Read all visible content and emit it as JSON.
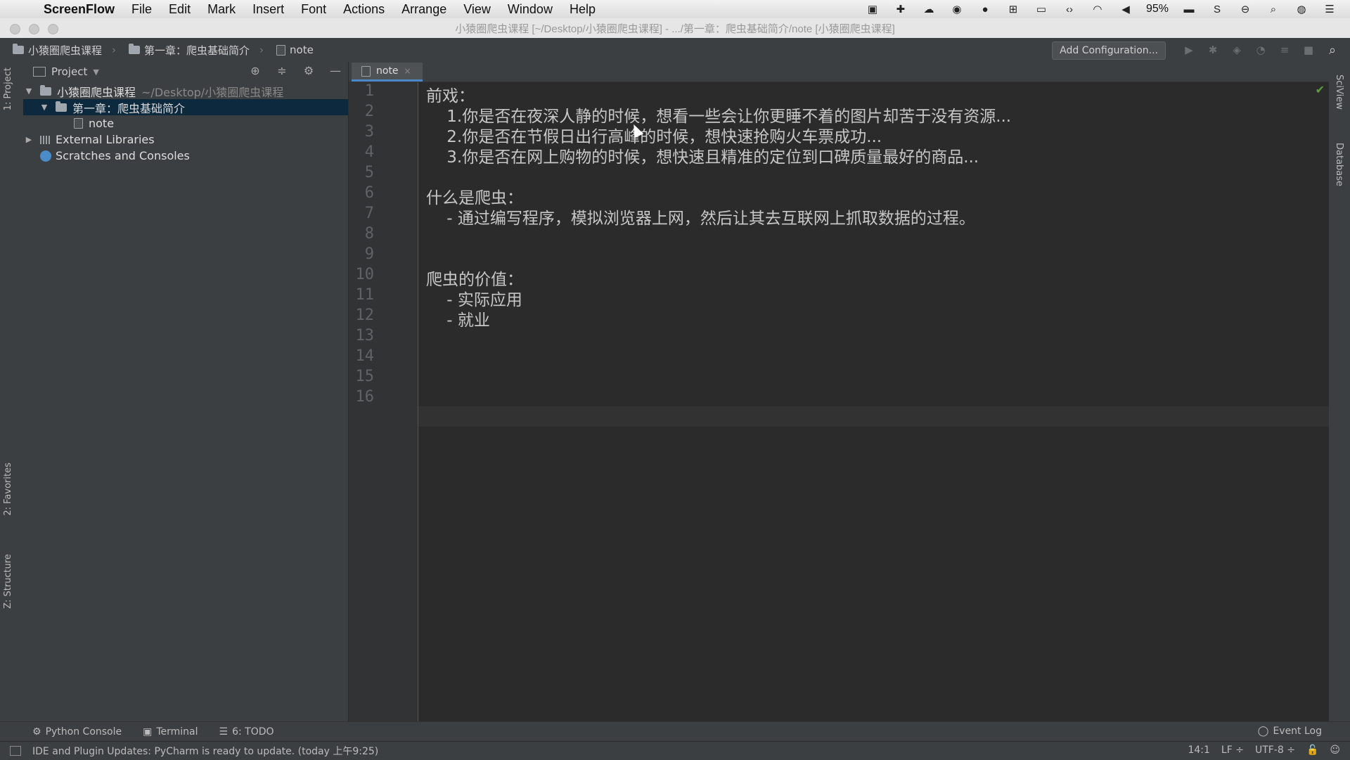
{
  "menubar": {
    "app_name": "ScreenFlow",
    "items": [
      "File",
      "Edit",
      "Mark",
      "Insert",
      "Font",
      "Actions",
      "Arrange",
      "View",
      "Window",
      "Help"
    ],
    "battery": "95%"
  },
  "window": {
    "title": "小猿圈爬虫课程 [~/Desktop/小猿圈爬虫课程] - .../第一章：爬虫基础简介/note [小猿圈爬虫课程]"
  },
  "navbar": {
    "crumbs": [
      "小猿圈爬虫课程",
      "第一章：爬虫基础简介",
      "note"
    ],
    "add_config": "Add Configuration..."
  },
  "left_strip": {
    "project": "1: Project",
    "favorites": "2: Favorites",
    "structure": "Z: Structure"
  },
  "right_strip": {
    "sciview": "SciView",
    "database": "Database"
  },
  "project_panel": {
    "title": "Project",
    "root_name": "小猿圈爬虫课程",
    "root_path": "~/Desktop/小猿圈爬虫课程",
    "chapter": "第一章：爬虫基础简介",
    "file": "note",
    "libraries": "External Libraries",
    "scratches": "Scratches and Consoles"
  },
  "editor": {
    "tab_label": "note",
    "line_numbers": [
      "1",
      "2",
      "3",
      "4",
      "5",
      "6",
      "7",
      "8",
      "9",
      "10",
      "11",
      "12",
      "13",
      "14",
      "15",
      "16"
    ],
    "lines": [
      "前戏：",
      "    1.你是否在夜深人静的时候，想看一些会让你更睡不着的图片却苦于没有资源...",
      "    2.你是否在节假日出行高峰的时候，想快速抢购火车票成功...",
      "    3.你是否在网上购物的时候，想快速且精准的定位到口碑质量最好的商品...",
      "",
      "什么是爬虫：",
      "    - 通过编写程序，模拟浏览器上网，然后让其去互联网上抓取数据的过程。",
      "",
      "",
      "爬虫的价值：",
      "    - 实际应用",
      "    - 就业",
      "",
      "",
      "",
      ""
    ]
  },
  "bottom_tools": {
    "python_console": "Python Console",
    "terminal": "Terminal",
    "todo": "6: TODO",
    "event_log": "Event Log"
  },
  "status": {
    "message": "IDE and Plugin Updates: PyCharm is ready to update. (today 上午9:25)",
    "position": "14:1",
    "line_sep": "LF ÷",
    "encoding": "UTF-8 ÷"
  }
}
